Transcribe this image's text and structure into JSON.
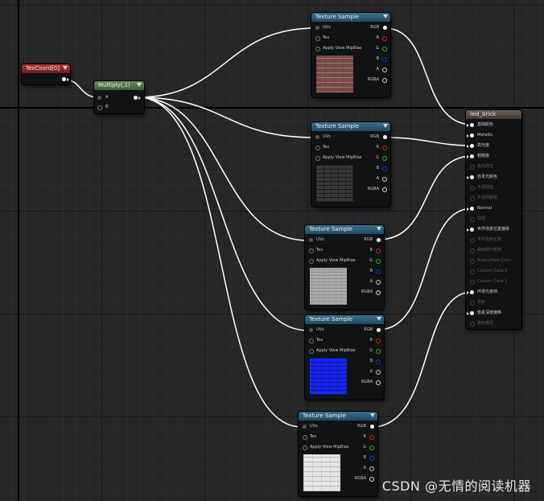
{
  "graph": {
    "texcoord": {
      "title": "TexCoord[0]"
    },
    "multiply": {
      "title": "Multiply(,1)",
      "pin_a": "A",
      "pin_b": "B"
    },
    "texture_sample_title": "Texture Sample",
    "texture_sample_inputs": [
      "UVs",
      "Tex",
      "Apply View MipBias"
    ],
    "texture_sample_outputs": [
      "RGB",
      "R",
      "G",
      "B",
      "A",
      "RGBA"
    ],
    "texture_samples": [
      {
        "thumbnail": "red-brick-texture"
      },
      {
        "thumbnail": "dark-brick-texture"
      },
      {
        "thumbnail": "gray-brick-texture"
      },
      {
        "thumbnail": "blue-normal-brick-texture"
      },
      {
        "thumbnail": "white-brick-texture"
      }
    ],
    "material": {
      "title": "red_brick",
      "inputs": [
        {
          "label": "基础颜色",
          "active": true
        },
        {
          "label": "Metallic",
          "active": true
        },
        {
          "label": "高光度",
          "active": true
        },
        {
          "label": "粗糙度",
          "active": true
        },
        {
          "label": "各向异性",
          "active": false
        },
        {
          "label": "自发光颜色",
          "active": true
        },
        {
          "label": "不透明度",
          "active": false
        },
        {
          "label": "不透明蒙版",
          "active": false
        },
        {
          "label": "Normal",
          "active": true
        },
        {
          "label": "切线",
          "active": false
        },
        {
          "label": "世界场景位置偏移",
          "active": true
        },
        {
          "label": "世界场景位移",
          "active": false
        },
        {
          "label": "曲面细分乘数",
          "active": false
        },
        {
          "label": "Subsurface Color",
          "active": false
        },
        {
          "label": "Custom Data 0",
          "active": false
        },
        {
          "label": "Custom Data 1",
          "active": false
        },
        {
          "label": "环境光遮挡",
          "active": true
        },
        {
          "label": "折射",
          "active": false
        },
        {
          "label": "像素深度偏移",
          "active": true
        },
        {
          "label": "着色模型",
          "active": false
        }
      ]
    }
  },
  "colors": {
    "background": "#262626",
    "wire": "#ffffff",
    "pin_r": "#e02020",
    "pin_g": "#20c020",
    "pin_b": "#2030e0",
    "pin_a": "#cccccc"
  },
  "watermark": "CSDN @无情的阅读机器"
}
